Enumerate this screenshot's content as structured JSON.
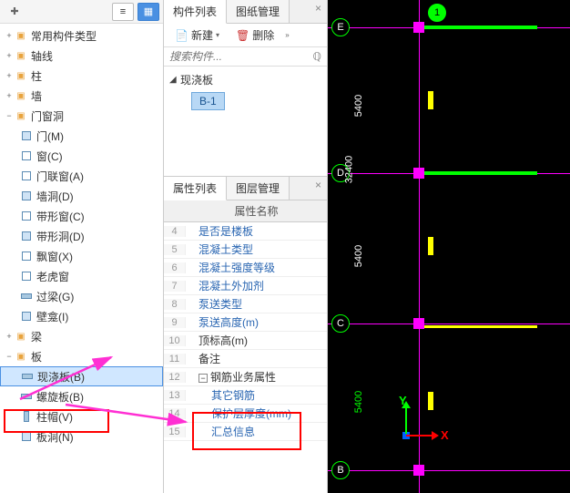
{
  "left_toolbar": {
    "list_view": "≡",
    "grid_view": "▦"
  },
  "nav_tree": [
    {
      "level": 0,
      "icon": "folder",
      "label": "常用构件类型",
      "exp": "+"
    },
    {
      "level": 0,
      "icon": "folder",
      "label": "轴线",
      "exp": "+"
    },
    {
      "level": 0,
      "icon": "folder",
      "label": "柱",
      "exp": "+"
    },
    {
      "level": 0,
      "icon": "folder",
      "label": "墙",
      "exp": "+"
    },
    {
      "level": 0,
      "icon": "folder",
      "label": "门窗洞",
      "exp": "−"
    },
    {
      "level": 1,
      "icon": "door",
      "label": "门(M)"
    },
    {
      "level": 1,
      "icon": "win",
      "label": "窗(C)"
    },
    {
      "level": 1,
      "icon": "win",
      "label": "门联窗(A)"
    },
    {
      "level": 1,
      "icon": "door",
      "label": "墙洞(D)"
    },
    {
      "level": 1,
      "icon": "win",
      "label": "带形窗(C)"
    },
    {
      "level": 1,
      "icon": "door",
      "label": "带形洞(D)"
    },
    {
      "level": 1,
      "icon": "win",
      "label": "飘窗(X)"
    },
    {
      "level": 1,
      "icon": "win",
      "label": "老虎窗"
    },
    {
      "level": 1,
      "icon": "slab",
      "label": "过梁(G)"
    },
    {
      "level": 1,
      "icon": "door",
      "label": "壁龛(I)"
    },
    {
      "level": 0,
      "icon": "folder",
      "label": "梁",
      "exp": "+"
    },
    {
      "level": 0,
      "icon": "folder",
      "label": "板",
      "exp": "−"
    },
    {
      "level": 1,
      "icon": "slab",
      "label": "现浇板(B)",
      "selected": true
    },
    {
      "level": 1,
      "icon": "slab",
      "label": "螺旋板(B)"
    },
    {
      "level": 1,
      "icon": "col",
      "label": "柱帽(V)"
    },
    {
      "level": 1,
      "icon": "door",
      "label": "板洞(N)"
    }
  ],
  "mid": {
    "tabs_top": {
      "a": "构件列表",
      "b": "图纸管理"
    },
    "toolbar": {
      "new": "新建",
      "delete": "删除"
    },
    "search_placeholder": "搜索构件...",
    "comp_root": "现浇板",
    "comp_child": "B-1",
    "tabs_prop": {
      "a": "属性列表",
      "b": "图层管理"
    },
    "prop_header": "属性名称",
    "props": [
      {
        "n": "4",
        "label": "是否是楼板",
        "cls": ""
      },
      {
        "n": "5",
        "label": "混凝土类型",
        "cls": ""
      },
      {
        "n": "6",
        "label": "混凝土强度等级",
        "cls": ""
      },
      {
        "n": "7",
        "label": "混凝土外加剂",
        "cls": ""
      },
      {
        "n": "8",
        "label": "泵送类型",
        "cls": ""
      },
      {
        "n": "9",
        "label": "泵送高度(m)",
        "cls": ""
      },
      {
        "n": "10",
        "label": "顶标高(m)",
        "cls": "black"
      },
      {
        "n": "11",
        "label": "备注",
        "cls": "black"
      },
      {
        "n": "12",
        "label": "钢筋业务属性",
        "cls": "black",
        "group": "−"
      },
      {
        "n": "13",
        "label": "其它钢筋",
        "cls": "sub"
      },
      {
        "n": "14",
        "label": "保护层厚度(mm)",
        "cls": "sub"
      },
      {
        "n": "15",
        "label": "汇总信息",
        "cls": "sub"
      }
    ]
  },
  "cad": {
    "bubbles": [
      "E",
      "D",
      "C",
      "B",
      "1"
    ],
    "dims": [
      "5400",
      "32400",
      "5400",
      "5400"
    ],
    "axis_x": "X",
    "axis_y": "Y"
  }
}
